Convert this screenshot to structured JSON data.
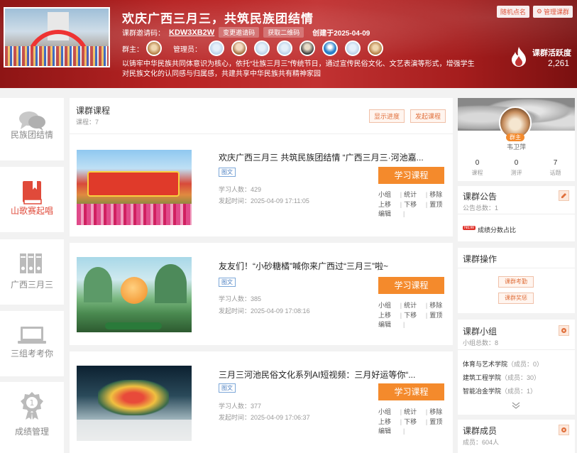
{
  "banner": {
    "title": "欢庆广西三月三，共筑民族团结情",
    "invite_label": "课群邀请码：",
    "invite_code": "KDW3XB2W",
    "change_code": "变更邀请码",
    "get_qr": "获取二维码",
    "created": "创建于2025-04-09",
    "owner_label": "群主：",
    "admin_label": "管理员：",
    "description": "以铸牢中华民族共同体意识为核心，依托“壮族三月三”传统节日，通过宣传民俗文化、文艺表演等形式，增强学生对民族文化的认同感与归属感，共建共享中华民族共有精神家园",
    "random_call": "随机点名",
    "manage": "管理课群",
    "activity_label": "课群活跃度",
    "activity_value": "2,261"
  },
  "nav": [
    {
      "label": "民族团结情",
      "icon": "chat-bubbles-icon",
      "active": false
    },
    {
      "label": "山歌赛起唱",
      "icon": "book-icon",
      "active": true
    },
    {
      "label": "广西三月三",
      "icon": "binders-icon",
      "active": false
    },
    {
      "label": "三组考考你",
      "icon": "laptop-icon",
      "active": false
    },
    {
      "label": "成绩管理",
      "icon": "medal-icon",
      "active": false
    }
  ],
  "main": {
    "title": "课群课程",
    "sub": "课程：7",
    "show_progress": "显示进度",
    "publish": "发起课程",
    "study_label": "学习课程",
    "ops": {
      "group": "小组",
      "stats": "统计",
      "remove": "移除",
      "up": "上移",
      "down": "下移",
      "top": "置顶",
      "edit": "编辑",
      "sep": "|"
    },
    "courses": [
      {
        "title": "欢庆广西三月三 共筑民族团结情 “广西三月三·河池嘉...",
        "tag": "图文",
        "learners": "学习人数：429",
        "time": "发起时间：2025-04-09 17:11:05"
      },
      {
        "title": "友友们！“小砂糖橘”喊你来广西过“三月三”啦~",
        "tag": "图文",
        "learners": "学习人数：385",
        "time": "发起时间：2025-04-09 17:08:16"
      },
      {
        "title": "三月三河池民俗文化系列AI短视频：三月好运等你“...",
        "tag": "图文",
        "learners": "学习人数：377",
        "time": "发起时间：2025-04-09 17:06:37"
      }
    ]
  },
  "profile": {
    "badge": "群主",
    "name": "韦卫萍",
    "stats": [
      {
        "value": "0",
        "label": "课程"
      },
      {
        "value": "0",
        "label": "测评"
      },
      {
        "value": "7",
        "label": "话题"
      }
    ]
  },
  "notice": {
    "title": "课群公告",
    "sub": "公告总数：1",
    "new": "NEW",
    "item": "成绩分数占比"
  },
  "operations": {
    "title": "课群操作",
    "btn1": "课群考勤",
    "btn2": "课群奖惩"
  },
  "groups": {
    "title": "课群小组",
    "sub": "小组总数：8",
    "items": [
      {
        "name": "体育与艺术学院",
        "members": "（成员：0）"
      },
      {
        "name": "建筑工程学院",
        "members": "（成员：30）"
      },
      {
        "name": "智能冶金学院",
        "members": "（成员：1）"
      }
    ]
  },
  "members": {
    "title": "课群成员",
    "sub": "成员：604人"
  },
  "colors": {
    "accent": "#f48a2c",
    "active_nav": "#e04a3a",
    "banner": "#b82424"
  }
}
